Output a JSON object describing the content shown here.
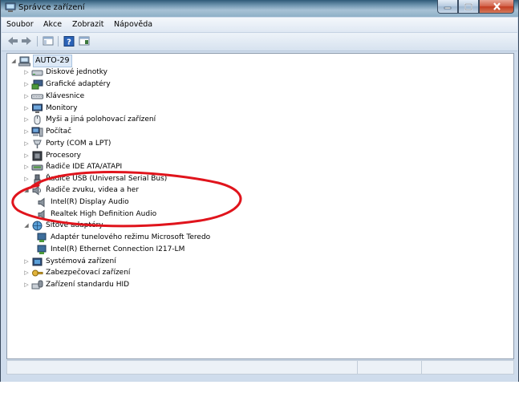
{
  "window": {
    "title": "Správce zařízení",
    "caption_buttons": {
      "minimize": "—",
      "maximize": "☐",
      "close": "✕"
    }
  },
  "menu": {
    "items": [
      {
        "label": "Soubor"
      },
      {
        "label": "Akce"
      },
      {
        "label": "Zobrazit"
      },
      {
        "label": "Nápověda"
      }
    ]
  },
  "toolbar": {
    "buttons": [
      "back-icon",
      "forward-icon",
      "console-tree-icon",
      "help-icon",
      "properties-icon"
    ]
  },
  "tree": {
    "root": {
      "label": "AUTO-29",
      "expander": "◢",
      "icon": "computer-icon"
    },
    "categories": [
      {
        "label": "Diskové jednotky",
        "icon": "disk-drive-icon",
        "expander": "▷"
      },
      {
        "label": "Grafické adaptéry",
        "icon": "display-adapter-icon",
        "expander": "▷"
      },
      {
        "label": "Klávesnice",
        "icon": "keyboard-icon",
        "expander": "▷"
      },
      {
        "label": "Monitory",
        "icon": "monitor-icon",
        "expander": "▷"
      },
      {
        "label": "Myši a jiná polohovací zařízení",
        "icon": "mouse-icon",
        "expander": "▷"
      },
      {
        "label": "Počítač",
        "icon": "computer-icon",
        "expander": "▷"
      },
      {
        "label": "Porty (COM a LPT)",
        "icon": "port-icon",
        "expander": "▷"
      },
      {
        "label": "Procesory",
        "icon": "processor-icon",
        "expander": "▷"
      },
      {
        "label": "Řadiče IDE ATA/ATAPI",
        "icon": "ide-controller-icon",
        "expander": "▷"
      },
      {
        "label": "Řadiče USB (Universal Serial Bus)",
        "icon": "usb-icon",
        "expander": "▷"
      },
      {
        "label": "Řadiče zvuku, videa a her",
        "icon": "speaker-icon",
        "expander": "◢",
        "children": [
          {
            "label": "Intel(R) Display Audio",
            "icon": "speaker-icon"
          },
          {
            "label": "Realtek High Definition Audio",
            "icon": "speaker-icon"
          }
        ]
      },
      {
        "label": "Síťové adaptéry",
        "icon": "network-adapter-icon",
        "expander": "◢",
        "children": [
          {
            "label": "Adaptér tunelového režimu Microsoft Teredo",
            "icon": "network-adapter-icon"
          },
          {
            "label": "Intel(R) Ethernet Connection I217-LM",
            "icon": "network-adapter-icon"
          }
        ]
      },
      {
        "label": "Systémová zařízení",
        "icon": "system-device-icon",
        "expander": "▷"
      },
      {
        "label": "Zabezpečovací zařízení",
        "icon": "security-device-icon",
        "expander": "▷"
      },
      {
        "label": "Zařízení standardu HID",
        "icon": "hid-icon",
        "expander": "▷"
      }
    ]
  },
  "colors": {
    "annotation_ellipse": "#e0141c",
    "title_bar": "#6d93ad",
    "selection": "#dce8f6"
  }
}
